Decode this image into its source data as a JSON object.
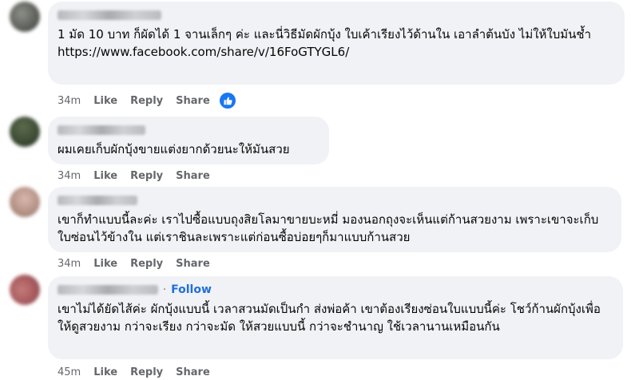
{
  "comments": [
    {
      "text": "1 มัด 10 บาท ก็ผัดได้ 1 จานเล็กๆ ค่ะ และนี่วิธีมัดผักบุ้ง ใบเค้าเรียงไว้ด้านใน เอาลำต้นบัง ไม่ให้ใบมันช้ำ\nhttps://www.facebook.com/share/v/16FoGTYGL6/",
      "time": "34m",
      "like": "Like",
      "reply": "Reply",
      "share": "Share",
      "reaction": "like-icon"
    },
    {
      "text": "ผมเคยเก็บผักบุ้งขายแต่งยากด้วยนะให้มันสวย",
      "time": "34m",
      "like": "Like",
      "reply": "Reply",
      "share": "Share"
    },
    {
      "text": "เขาก็ทำแบบนี้ละค่ะ เราไปซื้อแบบถุงสิยโลมาขายบะหมี่ มองนอกถุงจะเห็นแต่ก้านสวยงาม เพราะเขาจะเก็บใบซ่อนไว้ข้างใน แต่เราชินละเพราะแต่ก่อนซื้อบ่อยๆก็มาแบบก้านสวย",
      "time": "34m",
      "like": "Like",
      "reply": "Reply",
      "share": "Share"
    },
    {
      "dot": "·",
      "follow": "Follow",
      "text": "เขาไม่ได้ยัดไส้ค่ะ ผักบุ้งแบบนี้ เวลาสวนมัดเป็นกำ ส่งพ่อค้า เขาต้องเรียงซ่อนใบแบบนี้ค่ะ โชว์ก้านผักบุ้งเพื่อให้ดูสวยงาม กว่าจะเรียง กว่าจะมัด ให้สวยแบบนี้ กว่าจะชำนาญ ใช้เวลานานเหมือนกัน",
      "time": "45m",
      "like": "Like",
      "reply": "Reply",
      "share": "Share"
    }
  ],
  "colors": {
    "bubble": "#f0f2f5",
    "meta": "#65676b",
    "link": "#216fdb",
    "like_badge": "#1877f2"
  }
}
